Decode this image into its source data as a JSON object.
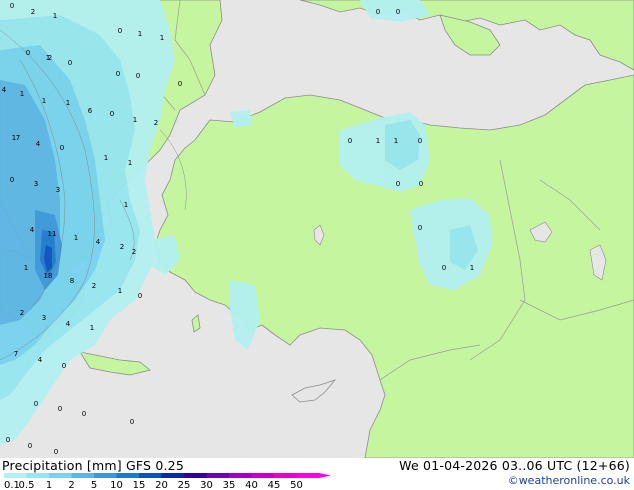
{
  "header": {
    "title": "Precipitation [mm]  GFS 0.25",
    "timestamp": "We 01-04-2026 03..06 UTC (12+66)",
    "credit": "©weatheronline.co.uk"
  },
  "legend": {
    "labels": [
      "0.1",
      "0.5",
      "1",
      "2",
      "5",
      "10",
      "15",
      "20",
      "25",
      "30",
      "35",
      "40",
      "45",
      "50"
    ],
    "colors": [
      "#b4f0f0",
      "#96e6f0",
      "#78d2f0",
      "#5ab4e6",
      "#3c96dc",
      "#1e78d2",
      "#0a50be",
      "#0a28aa",
      "#32009c",
      "#6e00b4",
      "#a000c8",
      "#c800c8",
      "#e600c8",
      "#fa00e6"
    ]
  },
  "map": {
    "colors": {
      "sea": "#e6e6e6",
      "land": "#c6f5a0",
      "border": "#9a9a9a",
      "coast": "#8c8c8c"
    },
    "values": [
      {
        "text": "0"
      },
      {
        "text": "2"
      },
      {
        "text": "1"
      },
      {
        "text": "0"
      },
      {
        "text": "1"
      },
      {
        "text": "1"
      },
      {
        "text": "0"
      },
      {
        "text": "0"
      },
      {
        "text": "1"
      },
      {
        "text": "0"
      },
      {
        "text": "2"
      },
      {
        "text": "0"
      },
      {
        "text": "0"
      },
      {
        "text": "1"
      },
      {
        "text": "4"
      },
      {
        "text": "1"
      },
      {
        "text": "1"
      },
      {
        "text": "6"
      },
      {
        "text": "0"
      },
      {
        "text": "1"
      },
      {
        "text": "2"
      },
      {
        "text": "1"
      },
      {
        "text": "7"
      },
      {
        "text": "4"
      },
      {
        "text": "0"
      },
      {
        "text": "1"
      },
      {
        "text": "1"
      },
      {
        "text": "0"
      },
      {
        "text": "3"
      },
      {
        "text": "3"
      },
      {
        "text": "1"
      },
      {
        "text": "4"
      },
      {
        "text": "11"
      },
      {
        "text": "1"
      },
      {
        "text": "4"
      },
      {
        "text": "2"
      },
      {
        "text": "1"
      },
      {
        "text": "2"
      },
      {
        "text": "18"
      },
      {
        "text": "8"
      },
      {
        "text": "2"
      },
      {
        "text": "1"
      },
      {
        "text": "0"
      },
      {
        "text": "2"
      },
      {
        "text": "3"
      },
      {
        "text": "4"
      },
      {
        "text": "1"
      },
      {
        "text": "7"
      },
      {
        "text": "4"
      },
      {
        "text": "0"
      },
      {
        "text": "0"
      },
      {
        "text": "0"
      },
      {
        "text": "0"
      },
      {
        "text": "0"
      },
      {
        "text": "0"
      },
      {
        "text": "0"
      },
      {
        "text": "0"
      },
      {
        "text": "0"
      },
      {
        "text": "1"
      },
      {
        "text": "1"
      },
      {
        "text": "0"
      },
      {
        "text": "0"
      },
      {
        "text": "0"
      },
      {
        "text": "0"
      },
      {
        "text": "0"
      },
      {
        "text": "1"
      },
      {
        "text": "0"
      },
      {
        "text": "0"
      }
    ]
  }
}
